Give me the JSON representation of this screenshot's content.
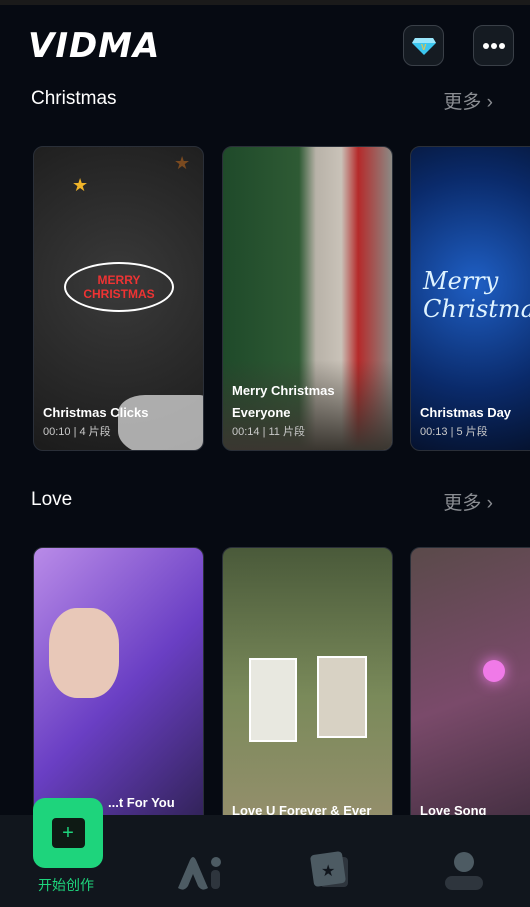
{
  "header": {
    "logo": "VIDMA",
    "premium_icon": "diamond-icon",
    "more_icon": "ellipsis-icon"
  },
  "sections": [
    {
      "title": "Christmas",
      "more": "更多 ›",
      "cards": [
        {
          "title": "Christmas Clicks",
          "meta": "00:10 | 4 片段",
          "image_text": "MERRY CHRISTMAS"
        },
        {
          "title": "Merry Christmas Everyone",
          "meta": "00:14 | 11 片段"
        },
        {
          "title": "Christmas Day",
          "meta": "00:13 | 5 片段",
          "image_text": "Merry Christmas"
        }
      ]
    },
    {
      "title": "Love",
      "more": "更多 ›",
      "cards": [
        {
          "title": "...t For You"
        },
        {
          "title": "Love U Forever & Ever"
        },
        {
          "title": "Love Song"
        }
      ]
    }
  ],
  "nav": {
    "create_label": "开始创作",
    "accent": "#1ed47c",
    "items": [
      "create-icon",
      "ai-icon",
      "templates-icon",
      "profile-icon"
    ]
  }
}
